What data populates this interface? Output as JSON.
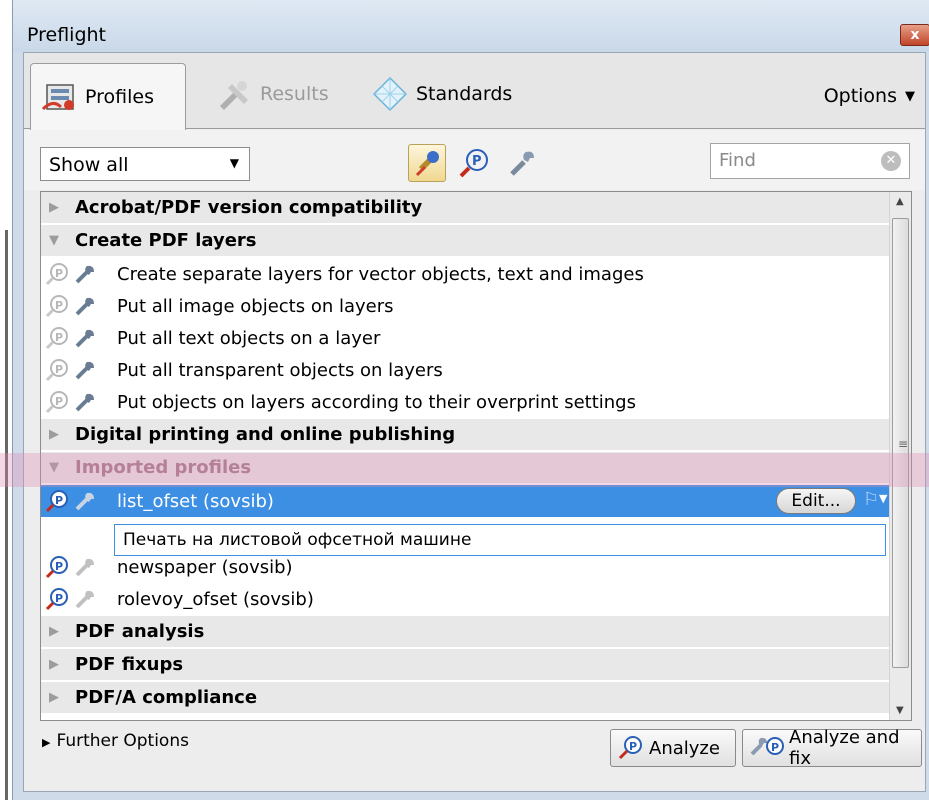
{
  "window": {
    "title": "Preflight",
    "close_label": "x"
  },
  "tabs": [
    {
      "label": "Profiles",
      "icon": "profiles-icon"
    },
    {
      "label": "Results",
      "icon": "results-icon"
    },
    {
      "label": "Standards",
      "icon": "standards-icon"
    }
  ],
  "options_label": "Options",
  "toolbar": {
    "filter_value": "Show all",
    "find_placeholder": "Find"
  },
  "list": {
    "groups": [
      {
        "label": "Acrobat/PDF version compatibility",
        "expanded": false
      },
      {
        "label": "Create PDF layers",
        "expanded": true,
        "items": [
          "Create separate layers for vector objects, text and images",
          "Put all image objects on layers",
          "Put all text objects on a layer",
          "Put all transparent objects on layers",
          "Put objects on layers according to their overprint settings"
        ]
      },
      {
        "label": "Digital printing and online publishing",
        "expanded": false
      },
      {
        "label": "Imported profiles",
        "expanded": true,
        "items": [
          "list_ofset (sovsib)",
          "newspaper (sovsib)",
          "rolevoy_ofset (sovsib)"
        ]
      },
      {
        "label": "PDF analysis",
        "expanded": false
      },
      {
        "label": "PDF fixups",
        "expanded": false
      },
      {
        "label": "PDF/A compliance",
        "expanded": false
      }
    ],
    "selected_description": "Печать на листовой  офсетной машине",
    "edit_label": "Edit..."
  },
  "footer": {
    "further_options": "Further Options",
    "analyze": "Analyze",
    "analyze_and_fix": "Analyze and fix"
  },
  "colors": {
    "selection": "#3d8fe4",
    "group_bg": "#e8e8e8"
  }
}
